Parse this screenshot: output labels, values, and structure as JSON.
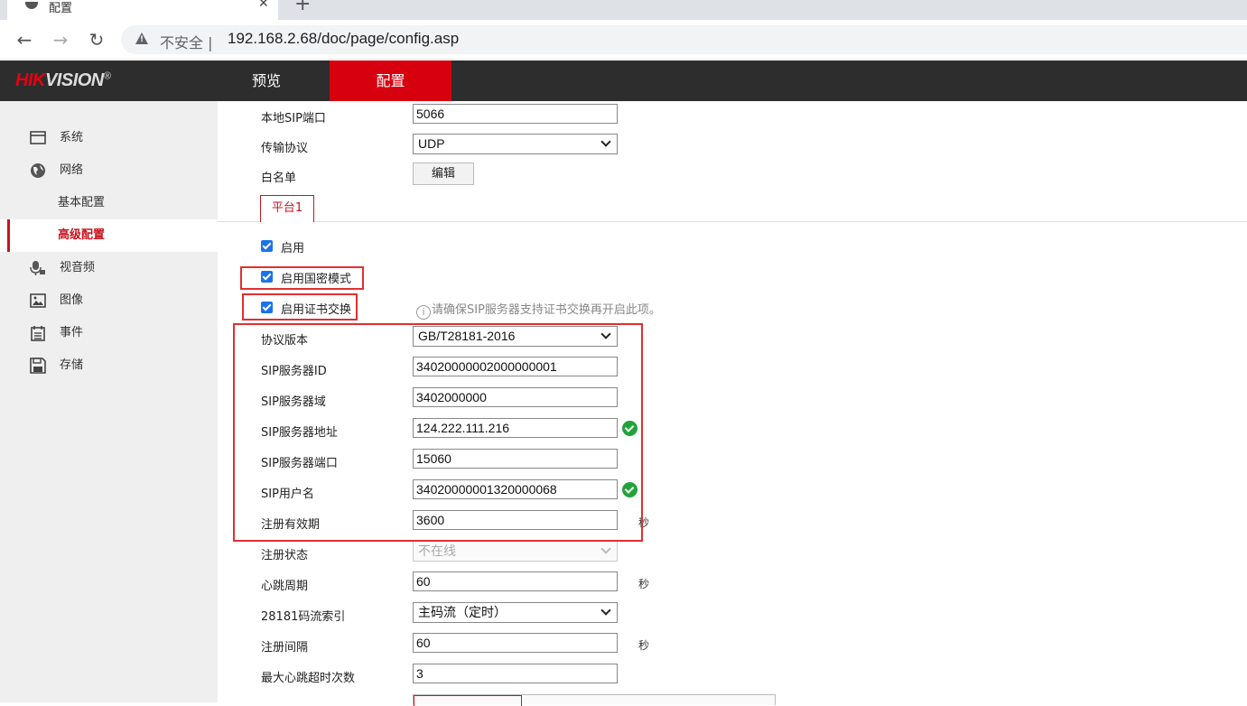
{
  "browser": {
    "tab_title": "配置",
    "insecure_label": "不安全",
    "url": "192.168.2.68/doc/page/config.asp"
  },
  "header": {
    "logo_red": "HIK",
    "logo_rest": "VISION",
    "logo_mark": "®",
    "nav": [
      "预览",
      "配置"
    ],
    "active_nav": "配置"
  },
  "sidebar": {
    "items": [
      {
        "label": "系统",
        "icon": "monitor-icon"
      },
      {
        "label": "网络",
        "icon": "globe-icon"
      },
      {
        "label": "视音频",
        "icon": "microphone-camera-icon"
      },
      {
        "label": "图像",
        "icon": "image-icon"
      },
      {
        "label": "事件",
        "icon": "calendar-icon"
      },
      {
        "label": "存储",
        "icon": "floppy-disk-icon"
      }
    ],
    "sub_items": [
      {
        "label": "基本配置"
      },
      {
        "label": "高级配置",
        "active": true
      }
    ]
  },
  "form": {
    "local_sip_port": {
      "label": "本地SIP端口",
      "value": "5066"
    },
    "transport": {
      "label": "传输协议",
      "value": "UDP"
    },
    "whitelist": {
      "label": "白名单",
      "button": "编辑"
    },
    "platform_tab": "平台1",
    "enable": {
      "label": "启用",
      "checked": true
    },
    "enable_gm": {
      "label": "启用国密模式",
      "checked": true
    },
    "enable_cert": {
      "label": "启用证书交换",
      "checked": true
    },
    "cert_hint": "请确保SIP服务器支持证书交换再开启此项。",
    "protocol_version": {
      "label": "协议版本",
      "value": "GB/T28181-2016"
    },
    "sip_server_id": {
      "label": "SIP服务器ID",
      "value": "34020000002000000001"
    },
    "sip_server_domain": {
      "label": "SIP服务器域",
      "value": "3402000000"
    },
    "sip_server_addr": {
      "label": "SIP服务器地址",
      "value": "124.222.111.216"
    },
    "sip_server_port": {
      "label": "SIP服务器端口",
      "value": "15060"
    },
    "sip_username": {
      "label": "SIP用户名",
      "value": "34020000001320000068"
    },
    "reg_validity": {
      "label": "注册有效期",
      "value": "3600",
      "unit": "秒"
    },
    "reg_status": {
      "label": "注册状态",
      "value": "不在线"
    },
    "heartbeat": {
      "label": "心跳周期",
      "value": "60",
      "unit": "秒"
    },
    "stream_index": {
      "label": "28181码流索引",
      "value": "主码流（定时）"
    },
    "reg_interval": {
      "label": "注册间隔",
      "value": "60",
      "unit": "秒"
    },
    "max_heartbeat_timeout": {
      "label": "最大心跳超时次数",
      "value": "3"
    }
  },
  "colors": {
    "accent": "#d7000f",
    "highlight_box": "#e03030",
    "valid": "#22a33a",
    "checkbox": "#1a73e8"
  }
}
